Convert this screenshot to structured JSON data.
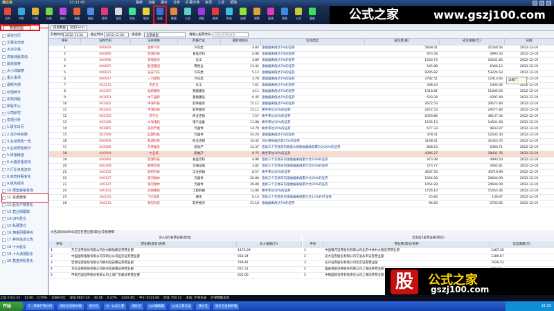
{
  "window": {
    "app": "通达信",
    "clock": "15:33:45",
    "menus": [
      "系统",
      "功能",
      "报价",
      "分析",
      "扩展市场",
      "资讯",
      "工具",
      "帮助"
    ]
  },
  "toolbar": [
    {
      "label": "分时",
      "color": "#e24a3a"
    },
    {
      "label": "K线",
      "color": "#3aa7e2"
    },
    {
      "label": "行情",
      "color": "#e2b33a"
    },
    {
      "label": "分析",
      "color": "#7fd14a"
    },
    {
      "label": "报价",
      "color": "#c54ae2"
    },
    {
      "label": "涨幅",
      "color": "#e2663a"
    },
    {
      "label": "指标",
      "color": "#4a8ee2"
    },
    {
      "label": "综合",
      "color": "#e23a7d"
    },
    {
      "label": "龙虎",
      "color": "#d9d9d9"
    },
    {
      "label": "资金",
      "color": "#3ae29b"
    },
    {
      "label": "板块",
      "color": "#e2d43a"
    },
    {
      "label": "自选",
      "color": "#3a6ee2"
    },
    {
      "label": "数据",
      "color": "#e28a3a"
    },
    {
      "label": "公告",
      "color": "#5ad2c8"
    },
    {
      "label": "研报",
      "color": "#9e3ae2"
    },
    {
      "label": "新闻",
      "color": "#e23a3a"
    },
    {
      "label": "财务",
      "color": "#3ac2e2"
    },
    {
      "label": "选股",
      "color": "#8ee23a"
    },
    {
      "label": "预警",
      "color": "#e2a23a"
    },
    {
      "label": "画线",
      "color": "#e23ab8"
    },
    {
      "label": "帮助",
      "color": "#3a8ae2"
    },
    {
      "label": "公式",
      "color": "#c8c83a"
    },
    {
      "label": "更新",
      "color": "#3ae25a"
    }
  ],
  "watermark_top": {
    "cn": "公式之家",
    "url": "www.gszj100.com"
  },
  "left_panel": {
    "tab": "数据挖掘",
    "items": [
      "投资日历",
      "交易龙虎榜",
      "大宗交易",
      "高管持股变动",
      "融资融券",
      "大小非解禁",
      "重大事项",
      "最新内部",
      "价值统计",
      "机构持股",
      "新股中心",
      "公司研究",
      "宏观分析",
      "1.股东日历",
      "2.深沪停复牌",
      "3.业绩预告一览",
      "4.业绩预告统计",
      "5.研报精选",
      "6.大盘资金流向",
      "7.行业资金流向",
      "8.高管持股变化",
      "9.机构观点",
      "10.限售解禁查询",
      "11.龙虎榜单",
      "12.股东户数变化",
      "13.营业部跟踪",
      "14.QFII重仓",
      "15.私募重仓",
      "16.佣金回报排名",
      "17.券商信息公告",
      "18.十大股东",
      "19.十大流通股东",
      "20.基金持股变化"
    ],
    "selected_index": 23
  },
  "main": {
    "buttons": [
      "提取数据",
      "导出Excel"
    ],
    "filter": {
      "start_label": "开始时间",
      "start_value": "2012-11-20",
      "end_label": "截止时间",
      "end_value": "2012-12-20",
      "type_label": "请选择",
      "type_value": "全部类型",
      "code_label": "请输入股票代码",
      "code_placeholder": "代码/名称/拼音"
    },
    "columns": [
      "序号",
      "证券代码",
      "证券简称",
      "所属行业",
      "最新收盘价",
      "异动类型",
      "成交量(股)",
      "成交金额(元)",
      "日期"
    ],
    "rows": [
      [
        "1",
        "600609",
        "金杯汽车",
        "汽车类",
        "3.83",
        "涨幅偏离值达7%的证券",
        "5838.01",
        "21540.56",
        "2012-12-19"
      ],
      [
        "2",
        "600866",
        "星湖科技",
        "食品饮料",
        "4.98",
        "涨幅偏离值达7%的证券",
        "973.39",
        "4993.50",
        "2012-12-19"
      ],
      [
        "3",
        "600992",
        "贵绳股份",
        "化工",
        "3.89",
        "涨幅偏离值达7%的证券",
        "1543.74",
        "10541.80",
        "2012-12-19"
      ],
      [
        "4",
        "600697",
        "欧亚集团",
        "零售业",
        "13.42",
        "涨幅偏离值达7%的证券",
        "545.88",
        "6346.12",
        "2012-12-19"
      ],
      [
        "5",
        "000625",
        "长安汽车",
        "汽车类",
        "5.12",
        "涨幅偏离值达7%的证券",
        "9205.82",
        "53224.63",
        "2012-12-19"
      ],
      [
        "6",
        "600927",
        "一汽夏利",
        "汽车类",
        "4.78",
        "涨幅偏离值达7%的证券",
        "2782.51",
        "12913.64",
        "2012-12-19"
      ],
      [
        "7",
        "002215",
        "诺普信",
        "化工",
        "7.61",
        "涨幅偏离值达7%的证券",
        "308.23",
        "2304.06",
        "2012-12-19"
      ],
      [
        "8",
        "002307",
        "北新路桥",
        "基础建设",
        "4.11",
        "涨幅偏离值达7%的证券",
        "1318.81",
        "11605.63",
        "2012-12-19"
      ],
      [
        "9",
        "002051",
        "中工国际",
        "基础建设",
        "6.45",
        "涨幅偏离值达7%的证券",
        "503.38",
        "4297.40",
        "2012-12-19"
      ],
      [
        "10",
        "002401",
        "中海科技",
        "软件服务",
        "15.11",
        "涨幅偏离值达7%的证券",
        "2672.53",
        "29577.80",
        "2012-12-19"
      ],
      [
        "11",
        "002401",
        "中海科技",
        "软件服务",
        "15.11",
        "换手率达20%的证券",
        "2672.53",
        "29577.80",
        "2012-12-19"
      ],
      [
        "12",
        "002356",
        "浩宁达",
        "商业连锁",
        "7.57",
        "换手率达20%的证券",
        "6359.86",
        "46137.34",
        "2012-12-19"
      ],
      [
        "13",
        "002306",
        "大洋电机",
        "电气设备",
        "11.88",
        "换手率达20%的证券",
        "1165.13",
        "14501.68",
        "2012-12-19"
      ],
      [
        "14",
        "002665",
        "首航节能",
        "元器件",
        "14.70",
        "换手率达20%的证券",
        "677.33",
        "9833.97",
        "2012-12-19"
      ],
      [
        "15",
        "002569",
        "蓝黛科技",
        "元器件",
        "24.20",
        "涨幅偏离值达7%的证券",
        "378.01",
        "12032.30",
        "2012-12-19"
      ],
      [
        "16",
        "000909",
        "数源科技",
        "商业连锁",
        "10.45",
        "日价格振幅达到15%的证券",
        "3148.01",
        "31443.76",
        "2012-12-19"
      ],
      [
        "17",
        "002569",
        "天神娱乐",
        "房地产",
        "12.37",
        "连续三个交易日内收盘价格跌幅偏离值累计达20%的证券",
        "808.23",
        "6360.71",
        "2012-12-19"
      ],
      [
        "18",
        "000094",
        "大名城",
        "房地产",
        "9.75",
        "换手率达20%的证券",
        "4305.27",
        "29031.76",
        "2012-12-19"
      ],
      [
        "19",
        "600866",
        "星湖科技",
        "食品饮料",
        "4.98",
        "连续三个交易日内涨幅偏离值累计达20%的证券",
        "973.39",
        "4993.50",
        "2012-12-19"
      ],
      [
        "20",
        "600269",
        "赣粤高速",
        "交通设施",
        "3.82",
        "连续三个交易日内涨幅偏离值累计达20%的证券",
        "273.77",
        "2602.81",
        "2012-12-19"
      ],
      [
        "21",
        "300152",
        "燃控科技",
        "工业机械",
        "8.57",
        "换手率达20%的证券",
        "4637.50",
        "45719.99",
        "2012-12-19"
      ],
      [
        "22",
        "300127",
        "银河磁体",
        "元器件",
        "20.80",
        "连续三个交易日内涨幅偏离值累计达20%的证券",
        "1054.28",
        "20644.09",
        "2012-12-19"
      ],
      [
        "23",
        "300127",
        "银河磁体",
        "元器件",
        "20.80",
        "连续三个交易日内涨幅偏离值累计达20%的证券",
        "1054.28",
        "20644.09",
        "2012-12-19"
      ],
      [
        "24",
        "300103",
        "达刚路机",
        "工程机械",
        "13.86",
        "换手率达20%的证券",
        "1726.10",
        "15455.46",
        "2012-12-19"
      ],
      [
        "25",
        "300015",
        "*ST高新",
        "通讯",
        "6.14",
        "连续三个交易日内涨幅偏离值累计达15%的ST证券",
        "25.85",
        "136.67",
        "2012-12-19"
      ],
      [
        "26",
        "300231",
        "银信科技",
        "软件服务",
        "31.18",
        "涨幅偏离值达7%的证券",
        "94.83",
        "2763.65",
        "2012-12-19"
      ]
    ],
    "selected_row_index": 17,
    "tooltip": "详细门",
    "breakdown_caption": "大名城(000094)前五名营业部(席位)交易明细",
    "buy": {
      "caption": "买入前5名营业部(席位)",
      "columns": [
        "序号",
        "营业部(席位)名称",
        "买入金额(万)"
      ],
      "rows": [
        [
          "1",
          "方正证券股份有限公司台州解放路证券营业部",
          "1476.09"
        ],
        [
          "2",
          "中国国际金融有限公司深圳分公司远见证券营业部",
          "918.34"
        ],
        [
          "3",
          "宏源证券股份有限公司杭州延安路证券营业部",
          "799.41"
        ],
        [
          "4",
          "方正证券股份有限公司杭州延安路证券营业部",
          "615.31"
        ],
        [
          "5",
          "申银万国证券股份有限公司上海广东路证券营业部",
          "503.06"
        ]
      ]
    },
    "sell": {
      "caption": "卖出前5名营业部(席位)",
      "columns": [
        "序号",
        "营业部(席位)名称",
        "卖出金额(万)"
      ],
      "rows": [
        [
          "1",
          "中国银河证券股份有限公司北京中关村大街证券营业部",
          "1467.26"
        ],
        [
          "2",
          "光大证券股份有限公司宁波永丰证券营业部",
          "1389.67"
        ],
        [
          "3",
          "东兴证券股份有限公司北京证券营业部",
          "1026.53"
        ],
        [
          "4",
          "国泰君安证券股份有限公司上海证券营业部",
          "933.21"
        ],
        [
          "5",
          "中银国际证券有限责任公司上海证券营业部",
          "900.43"
        ]
      ]
    }
  },
  "watermark_bottom": {
    "gu": "股",
    "cn": "公式之家",
    "url": "gszj100.com"
  },
  "status": [
    "上证 2162.23",
    "12.80",
    "0.59%",
    "1089.0亿",
    "深证 8607.40",
    "40.08",
    "0.47%",
    "1243.4亿",
    "中小 4521.66",
    "创业 709.12",
    "主站: 沪深主站",
    "沪深数据正常"
  ],
  "taskbar": {
    "start": "开始",
    "tasks": [
      "5 - 新闻行情分析",
      "通达信金融终端",
      "通达信",
      "Q - 公式之家",
      "通达信",
      "公式编辑器",
      "公式之家论坛",
      "通达信",
      "通达信金融终端"
    ],
    "clock": "15:33"
  }
}
